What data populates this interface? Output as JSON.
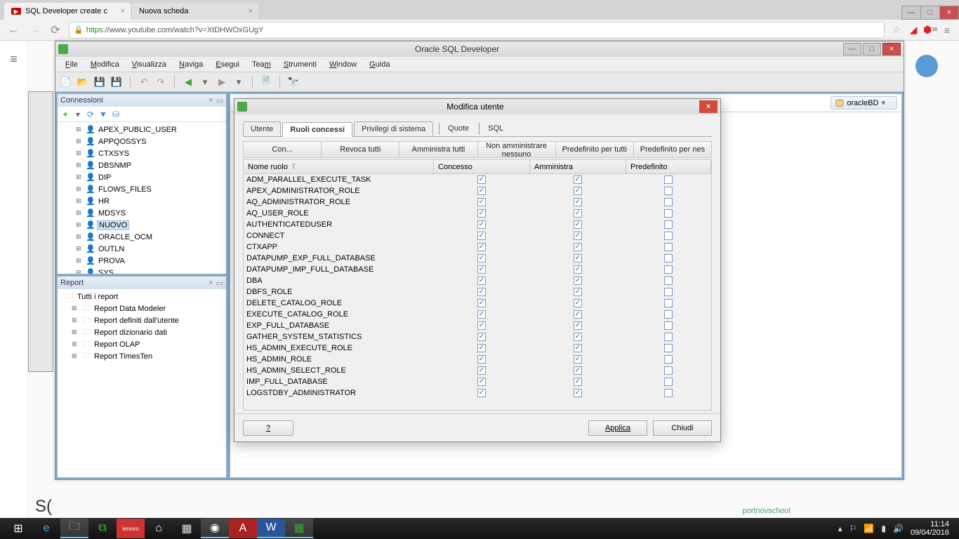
{
  "browser": {
    "tabs": [
      {
        "title": "SQL Developer create c",
        "favicon": "youtube"
      },
      {
        "title": "Nuova scheda",
        "favicon": "blank"
      }
    ],
    "url_https": "https",
    "url_rest": "://www.youtube.com/watch?v=XtDHWOxGUgY"
  },
  "sqldev": {
    "title": "Oracle SQL Developer",
    "menu": [
      "File",
      "Modifica",
      "Visualizza",
      "Naviga",
      "Esegui",
      "Team",
      "Strumenti",
      "Window",
      "Guida"
    ],
    "connections_panel": "Connessioni",
    "db_badge": "oracleBD",
    "users": [
      "APEX_PUBLIC_USER",
      "APPQOSSYS",
      "CTXSYS",
      "DBSNMP",
      "DIP",
      "FLOWS_FILES",
      "HR",
      "MDSYS",
      "NUOVO",
      "ORACLE_OCM",
      "OUTLN",
      "PROVA",
      "SYS"
    ],
    "selected_user": "NUOVO",
    "report_panel": "Report",
    "reports_root": "Tutti i report",
    "reports": [
      "Report Data Modeler",
      "Report definiti dall'utente",
      "Report dizionario dati",
      "Report OLAP",
      "Report TimesTen"
    ]
  },
  "dialog": {
    "title": "Modifica utente",
    "tabs": [
      "Utente",
      "Ruoli concessi",
      "Privilegi di sistema",
      "Quote",
      "SQL"
    ],
    "active_tab": 1,
    "buttons": [
      "Con...",
      "Revoca tutti",
      "Amministra tutti",
      "Non amministrare nessuno",
      "Predefinito per tutti",
      "Predefinito per nes"
    ],
    "columns": {
      "name": "Nome ruolo",
      "granted": "Concesso",
      "admin": "Amministra",
      "default": "Predefinito"
    },
    "roles": [
      {
        "name": "ADM_PARALLEL_EXECUTE_TASK",
        "g": true,
        "a": true,
        "p": false
      },
      {
        "name": "APEX_ADMINISTRATOR_ROLE",
        "g": true,
        "a": true,
        "p": false
      },
      {
        "name": "AQ_ADMINISTRATOR_ROLE",
        "g": true,
        "a": true,
        "p": false
      },
      {
        "name": "AQ_USER_ROLE",
        "g": true,
        "a": true,
        "p": false
      },
      {
        "name": "AUTHENTICATEDUSER",
        "g": true,
        "a": true,
        "p": false
      },
      {
        "name": "CONNECT",
        "g": true,
        "a": true,
        "p": false
      },
      {
        "name": "CTXAPP",
        "g": true,
        "a": true,
        "p": false
      },
      {
        "name": "DATAPUMP_EXP_FULL_DATABASE",
        "g": true,
        "a": true,
        "p": false
      },
      {
        "name": "DATAPUMP_IMP_FULL_DATABASE",
        "g": true,
        "a": true,
        "p": false
      },
      {
        "name": "DBA",
        "g": true,
        "a": true,
        "p": false
      },
      {
        "name": "DBFS_ROLE",
        "g": true,
        "a": true,
        "p": false
      },
      {
        "name": "DELETE_CATALOG_ROLE",
        "g": true,
        "a": true,
        "p": false
      },
      {
        "name": "EXECUTE_CATALOG_ROLE",
        "g": true,
        "a": true,
        "p": false
      },
      {
        "name": "EXP_FULL_DATABASE",
        "g": true,
        "a": true,
        "p": false
      },
      {
        "name": "GATHER_SYSTEM_STATISTICS",
        "g": true,
        "a": true,
        "p": false
      },
      {
        "name": "HS_ADMIN_EXECUTE_ROLE",
        "g": true,
        "a": true,
        "p": false
      },
      {
        "name": "HS_ADMIN_ROLE",
        "g": true,
        "a": true,
        "p": false
      },
      {
        "name": "HS_ADMIN_SELECT_ROLE",
        "g": true,
        "a": true,
        "p": false
      },
      {
        "name": "IMP_FULL_DATABASE",
        "g": true,
        "a": true,
        "p": false
      },
      {
        "name": "LOGSTDBY_ADMINISTRATOR",
        "g": true,
        "a": true,
        "p": false
      }
    ],
    "help_label": "?",
    "apply_label": "Applica",
    "close_label": "Chiudi"
  },
  "taskbar": {
    "time": "11:14",
    "date": "09/04/2016"
  },
  "yt": {
    "channel": "portnovschool"
  }
}
